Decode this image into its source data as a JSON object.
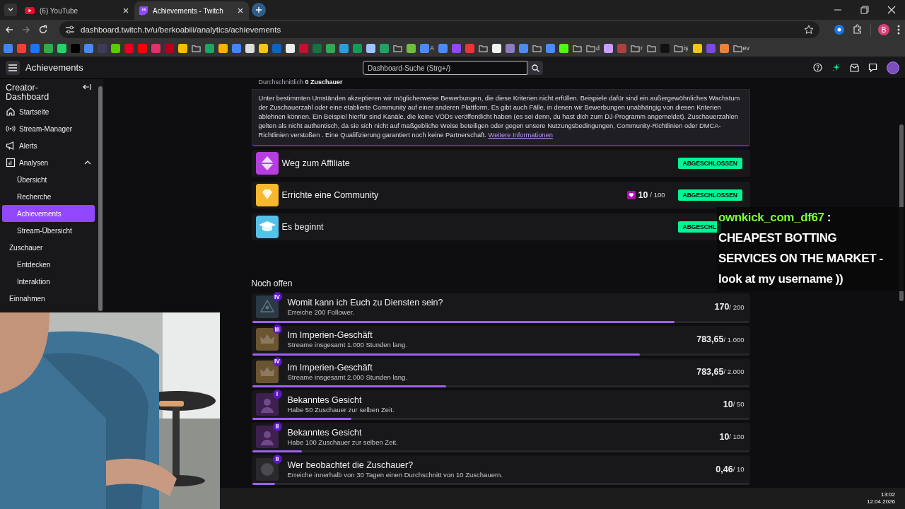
{
  "browser": {
    "tabs": [
      {
        "title": "(6) YouTube",
        "kind": "youtube",
        "selected": false
      },
      {
        "title": "Achievements - Twitch",
        "kind": "twitch",
        "selected": true
      }
    ],
    "url": "dashboard.twitch.tv/u/berkoabiii/analytics/achievements",
    "profile_initial": "B",
    "bookmarks": [
      {
        "kind": "logo",
        "color": "#4285f4"
      },
      {
        "kind": "logo",
        "color": "#ea4335"
      },
      {
        "kind": "logo",
        "color": "#1877f2"
      },
      {
        "kind": "logo",
        "color": "#34a853"
      },
      {
        "kind": "logo",
        "color": "#25d366"
      },
      {
        "kind": "logo",
        "color": "#000000"
      },
      {
        "kind": "logo",
        "color": "#4a8af4"
      },
      {
        "kind": "logo",
        "color": "#3c3c5a"
      },
      {
        "kind": "logo",
        "color": "#58cc02"
      },
      {
        "kind": "logo",
        "color": "#e60023"
      },
      {
        "kind": "logo",
        "color": "#ff0000"
      },
      {
        "kind": "logo",
        "color": "#e1306c"
      },
      {
        "kind": "logo",
        "color": "#b3001b"
      },
      {
        "kind": "logo",
        "color": "#fbbc04"
      },
      {
        "kind": "folder"
      },
      {
        "kind": "logo",
        "color": "#1fa463"
      },
      {
        "kind": "logo",
        "color": "#f4b400"
      },
      {
        "kind": "logo",
        "color": "#4285f5"
      },
      {
        "kind": "logo",
        "color": "#dddddd"
      },
      {
        "kind": "logo",
        "color": "#f6c026"
      },
      {
        "kind": "logo",
        "color": "#0a66c2"
      },
      {
        "kind": "logo",
        "color": "#eeeeee"
      },
      {
        "kind": "logo",
        "color": "#c8102e"
      },
      {
        "kind": "logo",
        "color": "#1d6f42"
      },
      {
        "kind": "logo",
        "color": "#34a854"
      },
      {
        "kind": "logo",
        "color": "#2d9cdb"
      },
      {
        "kind": "logo",
        "color": "#0f9d58"
      },
      {
        "kind": "logo",
        "color": "#a0c4ff"
      },
      {
        "kind": "logo",
        "color": "#21a366"
      },
      {
        "kind": "folder"
      },
      {
        "kind": "logo",
        "color": "#6fbf3c"
      },
      {
        "kind": "logo",
        "color": "#4c8bf5",
        "label": "A"
      },
      {
        "kind": "logo",
        "color": "#4c8bf6"
      },
      {
        "kind": "logo",
        "color": "#9146ff"
      },
      {
        "kind": "logo",
        "color": "#e53935"
      },
      {
        "kind": "folder"
      },
      {
        "kind": "logo",
        "color": "#f2f2f2"
      },
      {
        "kind": "logo",
        "color": "#8e7cc3"
      },
      {
        "kind": "logo",
        "color": "#4c8bf7"
      },
      {
        "kind": "folder"
      },
      {
        "kind": "logo",
        "color": "#4c8bf8"
      },
      {
        "kind": "logo",
        "color": "#53fc18"
      },
      {
        "kind": "folder"
      },
      {
        "kind": "folder",
        "label": "d"
      },
      {
        "kind": "logo",
        "color": "#c9a0ff"
      },
      {
        "kind": "logo",
        "color": "#b04040"
      },
      {
        "kind": "folder",
        "label": "r"
      },
      {
        "kind": "folder"
      },
      {
        "kind": "logo",
        "color": "#111111"
      },
      {
        "kind": "folder",
        "label": "iş"
      },
      {
        "kind": "logo",
        "color": "#f5c518"
      },
      {
        "kind": "logo",
        "color": "#7b4ae2"
      },
      {
        "kind": "logo",
        "color": "#e8833a"
      },
      {
        "kind": "folder",
        "label": "ev"
      }
    ]
  },
  "header": {
    "title": "Achievements",
    "search_placeholder": "Dashboard-Suche (Strg+/)"
  },
  "sidebar": {
    "title": "Creator-Dashboard",
    "items": [
      {
        "label": "Startseite",
        "kind": "home"
      },
      {
        "label": "Stream-Manager",
        "kind": "broadcast"
      },
      {
        "label": "Alerts",
        "kind": "megaphone"
      },
      {
        "label": "Analysen",
        "kind": "chart",
        "expanded": true,
        "children": [
          {
            "label": "Übersicht",
            "selected": false
          },
          {
            "label": "Recherche",
            "selected": false
          },
          {
            "label": "Achievements",
            "selected": true
          },
          {
            "label": "Stream-Übersicht",
            "selected": false
          }
        ]
      },
      {
        "label": "Zuschauer",
        "kind": "group",
        "children": [
          {
            "label": "Entdecken",
            "selected": false
          },
          {
            "label": "Interaktion",
            "selected": false
          }
        ]
      },
      {
        "label": "Einnahmen",
        "kind": "group"
      }
    ]
  },
  "main": {
    "stat_line": "Durchschnittlich **0 Zuschauer**",
    "notice": "Unter bestimmten Umständen akzeptieren wir möglicherweise Bewerbungen, die diese Kriterien nicht erfüllen. Beispiele dafür sind ein außergewöhnliches Wachstum der Zuschauerzahl oder eine etablierte Community auf einer anderen Plattform. Es gibt auch Fälle, in denen wir Bewerbungen unabhängig von diesen Kriterien ablehnen können. Ein Beispiel hierfür sind Kanäle, die keine VODs veröffentlicht haben (es sei denn, du hast dich zum DJ-Programm angemeldet). Zuschauerzahlen gelten als nicht authentisch, da sie sich nicht auf maßgebliche Weise beteiligen oder gegen unsere Nutzungsbedingungen, Community-Richtlinien oder DMCA-Richtlinien verstoßen . Eine Qualifizierung garantiert noch keine Partnerschaft.",
    "notice_link": "Weitere Informationen",
    "completed": [
      {
        "title": "Weg zum Affiliate",
        "kind": "affiliate",
        "badge": "ABGESCHLOSSEN"
      },
      {
        "title": "Errichte eine Community",
        "kind": "community",
        "value": "10",
        "total": "/ 100",
        "badge": "ABGESCHLOSSEN"
      },
      {
        "title": "Es beginnt",
        "kind": "start",
        "badge": "ABGESCHL"
      }
    ],
    "open_heading": "Noch offen",
    "open": [
      {
        "title": "Womit kann ich Euch zu Diensten sein?",
        "subtitle": "Erreiche 200 Follower.",
        "tier": "IV",
        "kind": "eye",
        "value": "170",
        "total": "/ 200",
        "level": 0.85
      },
      {
        "title": "Im Imperien-Geschäft",
        "subtitle": "Streame insgesamt 1.000 Stunden lang.",
        "tier": "III",
        "kind": "crown",
        "value": "783,65",
        "total": "/ 1.000",
        "level": 0.78
      },
      {
        "title": "Im Imperien-Geschäft",
        "subtitle": "Streame insgesamt 2.000 Stunden lang.",
        "tier": "IV",
        "kind": "crown",
        "value": "783,65",
        "total": "/ 2.000",
        "level": 0.39
      },
      {
        "title": "Bekanntes Gesicht",
        "subtitle": "Habe 50 Zuschauer zur selben Zeit.",
        "tier": "I",
        "kind": "person",
        "value": "10",
        "total": "/ 50",
        "level": 0.2
      },
      {
        "title": "Bekanntes Gesicht",
        "subtitle": "Habe 100 Zuschauer zur selben Zeit.",
        "tier": "II",
        "kind": "person",
        "value": "10",
        "total": "/ 100",
        "level": 0.1
      },
      {
        "title": "Wer beobachtet die Zuschauer?",
        "subtitle": "Erreiche innerhalb von 30 Tagen einen Durchschnitt von 10 Zuschauern.",
        "tier": "II",
        "kind": "face",
        "value": "0,46",
        "total": "/ 10",
        "level": 0.046
      }
    ]
  },
  "chat_overlay": {
    "username": "ownkick_com_df67",
    "separator": ":",
    "message_lines": [
      "CHEAPEST BOTTING",
      "SERVICES ON THE MARKET -",
      "look at my username ))"
    ]
  },
  "taskbar": {
    "time": "13:02",
    "date": "12.04.2026"
  }
}
